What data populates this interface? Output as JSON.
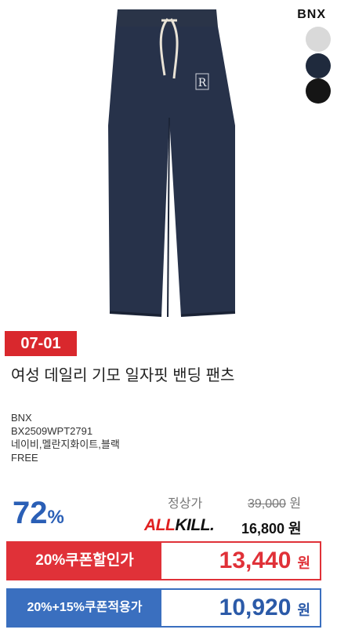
{
  "brand_logo": "BNX",
  "swatches": [
    "gray",
    "navy",
    "black"
  ],
  "date_badge": "07-01",
  "product_title": "여성 데일리 기모 일자핏 밴딩 팬츠",
  "info": {
    "brand": "BNX",
    "code": "BX2509WPT2791",
    "colors": "네이비,멜란지화이트,블랙",
    "size": "FREE"
  },
  "discount": {
    "number": "72",
    "percent": "%"
  },
  "regular": {
    "label": "정상가",
    "price": "39,000",
    "unit": "원"
  },
  "allkill": {
    "logo_a": "ALL",
    "logo_b": "KILL.",
    "price": "16,800 원"
  },
  "coupon": {
    "label": "20%쿠폰할인가",
    "price": "13,440",
    "unit": "원"
  },
  "extra": {
    "label": "20%+15%쿠폰적용가",
    "price": "10,920",
    "unit": "원"
  }
}
